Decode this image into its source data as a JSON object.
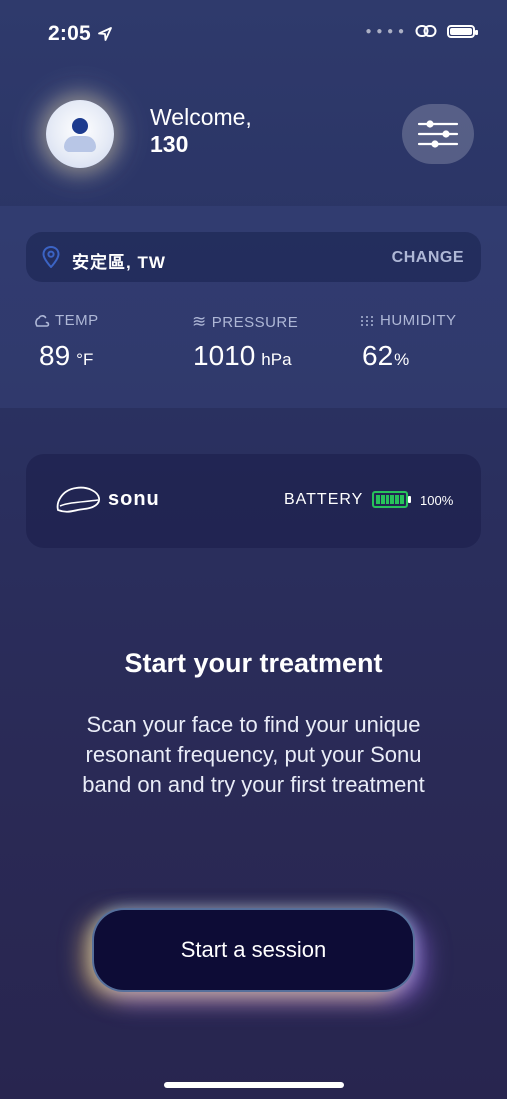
{
  "status_bar": {
    "time": "2:05"
  },
  "header": {
    "greeting": "Welcome,",
    "username": "130"
  },
  "location": {
    "name": "安定區, TW",
    "action": "CHANGE"
  },
  "weather": {
    "temp": {
      "label": "TEMP",
      "value": "89",
      "unit": "°F"
    },
    "pressure": {
      "label": "PRESSURE",
      "value": "1010",
      "unit": "hPa"
    },
    "humidity": {
      "label": "HUMIDITY",
      "value": "62",
      "unit": "%"
    }
  },
  "device": {
    "name": "sonu",
    "battery_label": "BATTERY",
    "battery_percent": "100%",
    "battery_level": 1.0,
    "battery_color": "#27c25b"
  },
  "treatment": {
    "title": "Start your treatment",
    "description": "Scan your face to find your unique resonant frequency, put your Sonu band on and try your first treatment",
    "button_label": "Start a session"
  }
}
